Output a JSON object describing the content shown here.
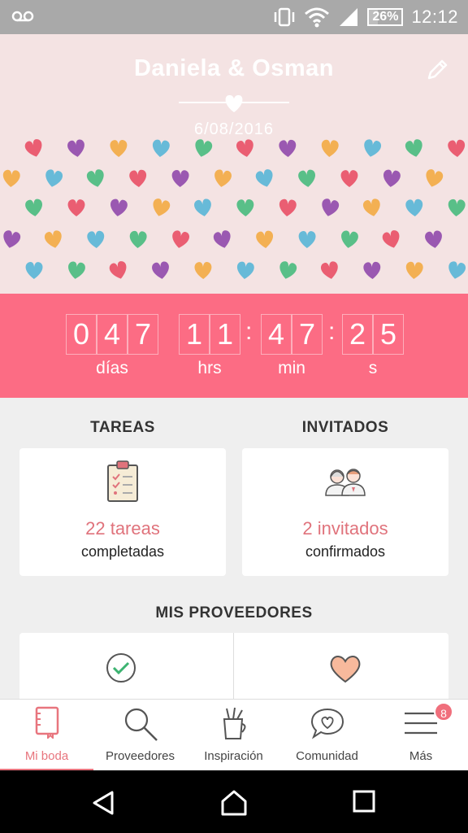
{
  "status": {
    "battery": "26%",
    "battery_level": 0.26,
    "time": "12:12"
  },
  "header": {
    "names": "Daniela & Osman",
    "date": "6/08/2016"
  },
  "countdown": {
    "days": [
      "0",
      "4",
      "7"
    ],
    "hours": [
      "1",
      "1"
    ],
    "minutes": [
      "4",
      "7"
    ],
    "seconds": [
      "2",
      "5"
    ],
    "labels": {
      "days": "días",
      "hours": "hrs",
      "minutes": "min",
      "seconds": "s"
    }
  },
  "tasks": {
    "title": "TAREAS",
    "count": "22 tareas",
    "label": "completadas"
  },
  "guests": {
    "title": "INVITADOS",
    "count": "2 invitados",
    "label": "confirmados"
  },
  "providers": {
    "title": "MIS PROVEEDORES"
  },
  "nav": {
    "items": [
      {
        "label": "Mi boda"
      },
      {
        "label": "Proveedores"
      },
      {
        "label": "Inspiración"
      },
      {
        "label": "Comunidad"
      },
      {
        "label": "Más"
      }
    ],
    "badge": "8"
  },
  "colors": {
    "accent": "#fc6c84",
    "header_bg": "#f4e3e3",
    "text_accent": "#e0737c"
  }
}
